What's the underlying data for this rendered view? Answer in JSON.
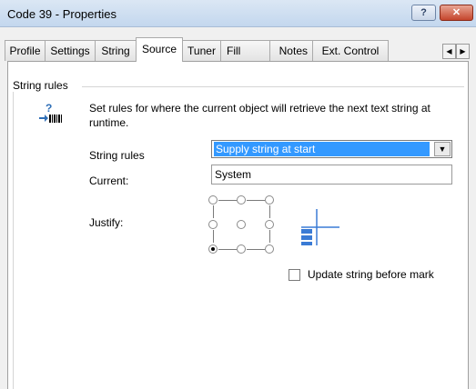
{
  "window": {
    "title": "Code 39 - Properties",
    "help_label": "?",
    "close_label": "✕"
  },
  "tabs": [
    {
      "label": "Profile",
      "active": false
    },
    {
      "label": "Settings",
      "active": false
    },
    {
      "label": "String",
      "active": false
    },
    {
      "label": "Source",
      "active": true
    },
    {
      "label": "Tuner",
      "active": false
    },
    {
      "label": "Fill",
      "active": false
    },
    {
      "label": "Notes",
      "active": false
    },
    {
      "label": "Ext. Control",
      "active": false
    }
  ],
  "tab_scroll": {
    "left_icon": "◀",
    "right_icon": "▶"
  },
  "group": {
    "title": "String rules",
    "icon": "barcode-icon",
    "description": "Set rules for where the current object will retrieve the next text string at runtime."
  },
  "fields": {
    "string_rules": {
      "label": "String rules",
      "value": "Supply string at start",
      "arrow": "▼"
    },
    "current": {
      "label": "Current:",
      "value": "System"
    },
    "justify": {
      "label": "Justify:",
      "selected": "bottom-left"
    },
    "update_string": {
      "label": "Update string before mark",
      "checked": false
    }
  },
  "colors": {
    "selection": "#3399ff",
    "panel_bg": "#ffffff",
    "window_bg": "#f0f0f0",
    "close_button": "#c5452c"
  }
}
